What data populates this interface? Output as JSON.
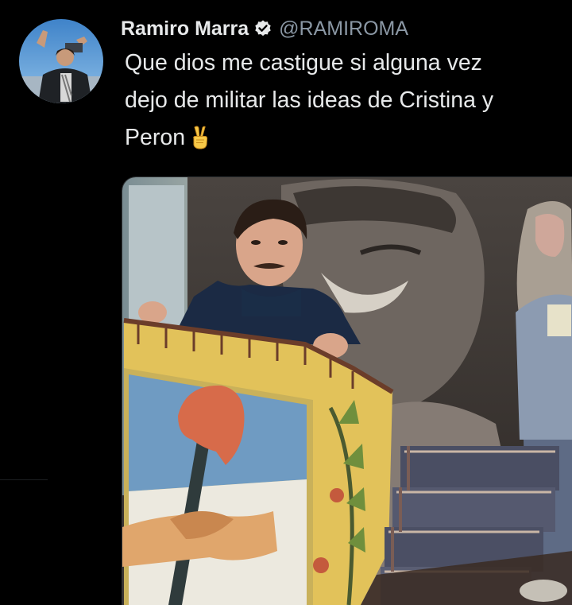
{
  "tweet": {
    "display_name": "Ramiro Marra",
    "handle": "@RAMIROMA",
    "text": "Que dios me castigue si alguna vez\ndejo de militar las ideas de Cristina y\nPeron",
    "emoji": "✌",
    "verified": true
  },
  "icons": {
    "verified": "verified-badge-icon"
  },
  "colors": {
    "background": "#000000",
    "text": "#e7e9ea",
    "handle": "#8b98a5"
  }
}
